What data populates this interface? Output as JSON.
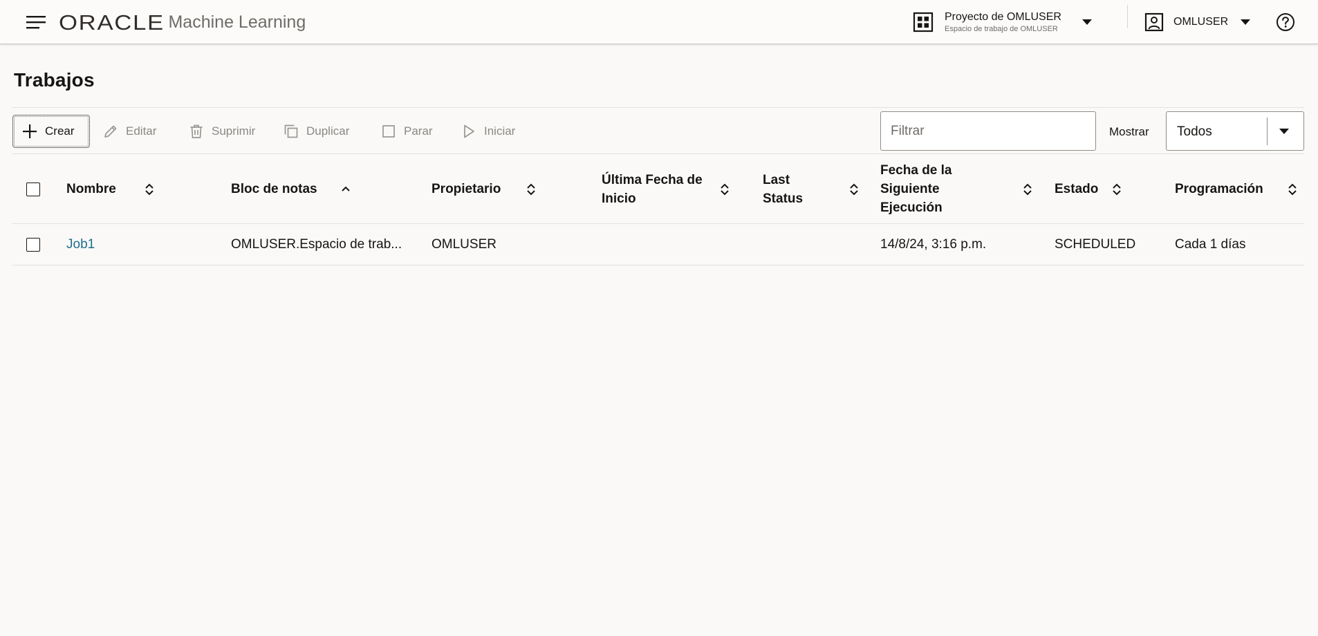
{
  "header": {
    "brand": "ORACLE",
    "product": "Machine Learning",
    "project_title": "Proyecto de OMLUSER",
    "project_subtitle": "Espacio de trabajo de OMLUSER",
    "user_name": "OMLUSER"
  },
  "page": {
    "title": "Trabajos"
  },
  "toolbar": {
    "create": "Crear",
    "edit": "Editar",
    "delete": "Suprimir",
    "duplicate": "Duplicar",
    "stop": "Parar",
    "start": "Iniciar",
    "filter_placeholder": "Filtrar",
    "show_label": "Mostrar",
    "show_value": "Todos"
  },
  "table": {
    "columns": [
      {
        "label": "Nombre",
        "sort": "both"
      },
      {
        "label": "Bloc de notas",
        "sort": "ascending"
      },
      {
        "label": "Propietario",
        "sort": "both"
      },
      {
        "label": "Última Fecha de Inicio",
        "sort": "both"
      },
      {
        "label": "Last Status",
        "sort": "both"
      },
      {
        "label": "Fecha de la Siguiente Ejecución",
        "sort": "both"
      },
      {
        "label": "Estado",
        "sort": "both"
      },
      {
        "label": "Programación",
        "sort": "both"
      }
    ],
    "rows": [
      {
        "name": "Job1",
        "notebook": "OMLUSER.Espacio de trab...",
        "owner": "OMLUSER",
        "last_start": "",
        "last_status": "",
        "next_run": "14/8/24, 3:16 p.m.",
        "status": "SCHEDULED",
        "schedule": "Cada 1 días"
      }
    ]
  },
  "colors": {
    "link": "#1f6d8c",
    "header_bg": "#fcfbfa",
    "page_bg": "#faf9f8",
    "disabled_text": "#8a8783"
  }
}
